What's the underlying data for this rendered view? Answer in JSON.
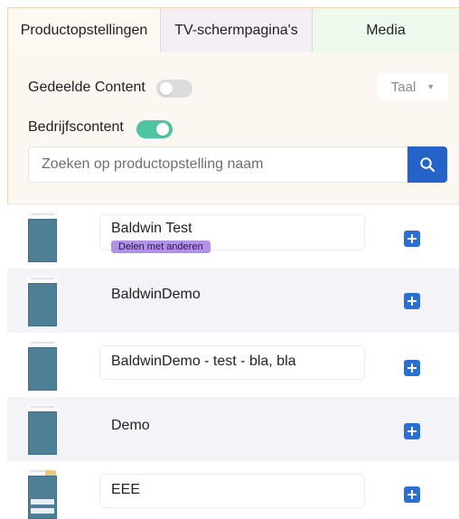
{
  "tabs": [
    {
      "label": "Productopstellingen"
    },
    {
      "label": "TV-schermpagina's"
    },
    {
      "label": "Media"
    }
  ],
  "filters": {
    "shared_content": {
      "label": "Gedeelde Content",
      "enabled": false
    },
    "company_content": {
      "label": "Bedrijfscontent",
      "enabled": true
    },
    "language": {
      "value": "Taal"
    }
  },
  "search": {
    "placeholder": "Zoeken op productopstelling naam"
  },
  "items": [
    {
      "name": "Baldwin Test",
      "badge": "Delen met anderen"
    },
    {
      "name": "BaldwinDemo"
    },
    {
      "name": "BaldwinDemo - test - bla, bla"
    },
    {
      "name": "Demo"
    },
    {
      "name": "EEE"
    }
  ],
  "colors": {
    "accent": "#2563c9",
    "toggle_on": "#4fc4a4",
    "badge": "#b191e7"
  }
}
